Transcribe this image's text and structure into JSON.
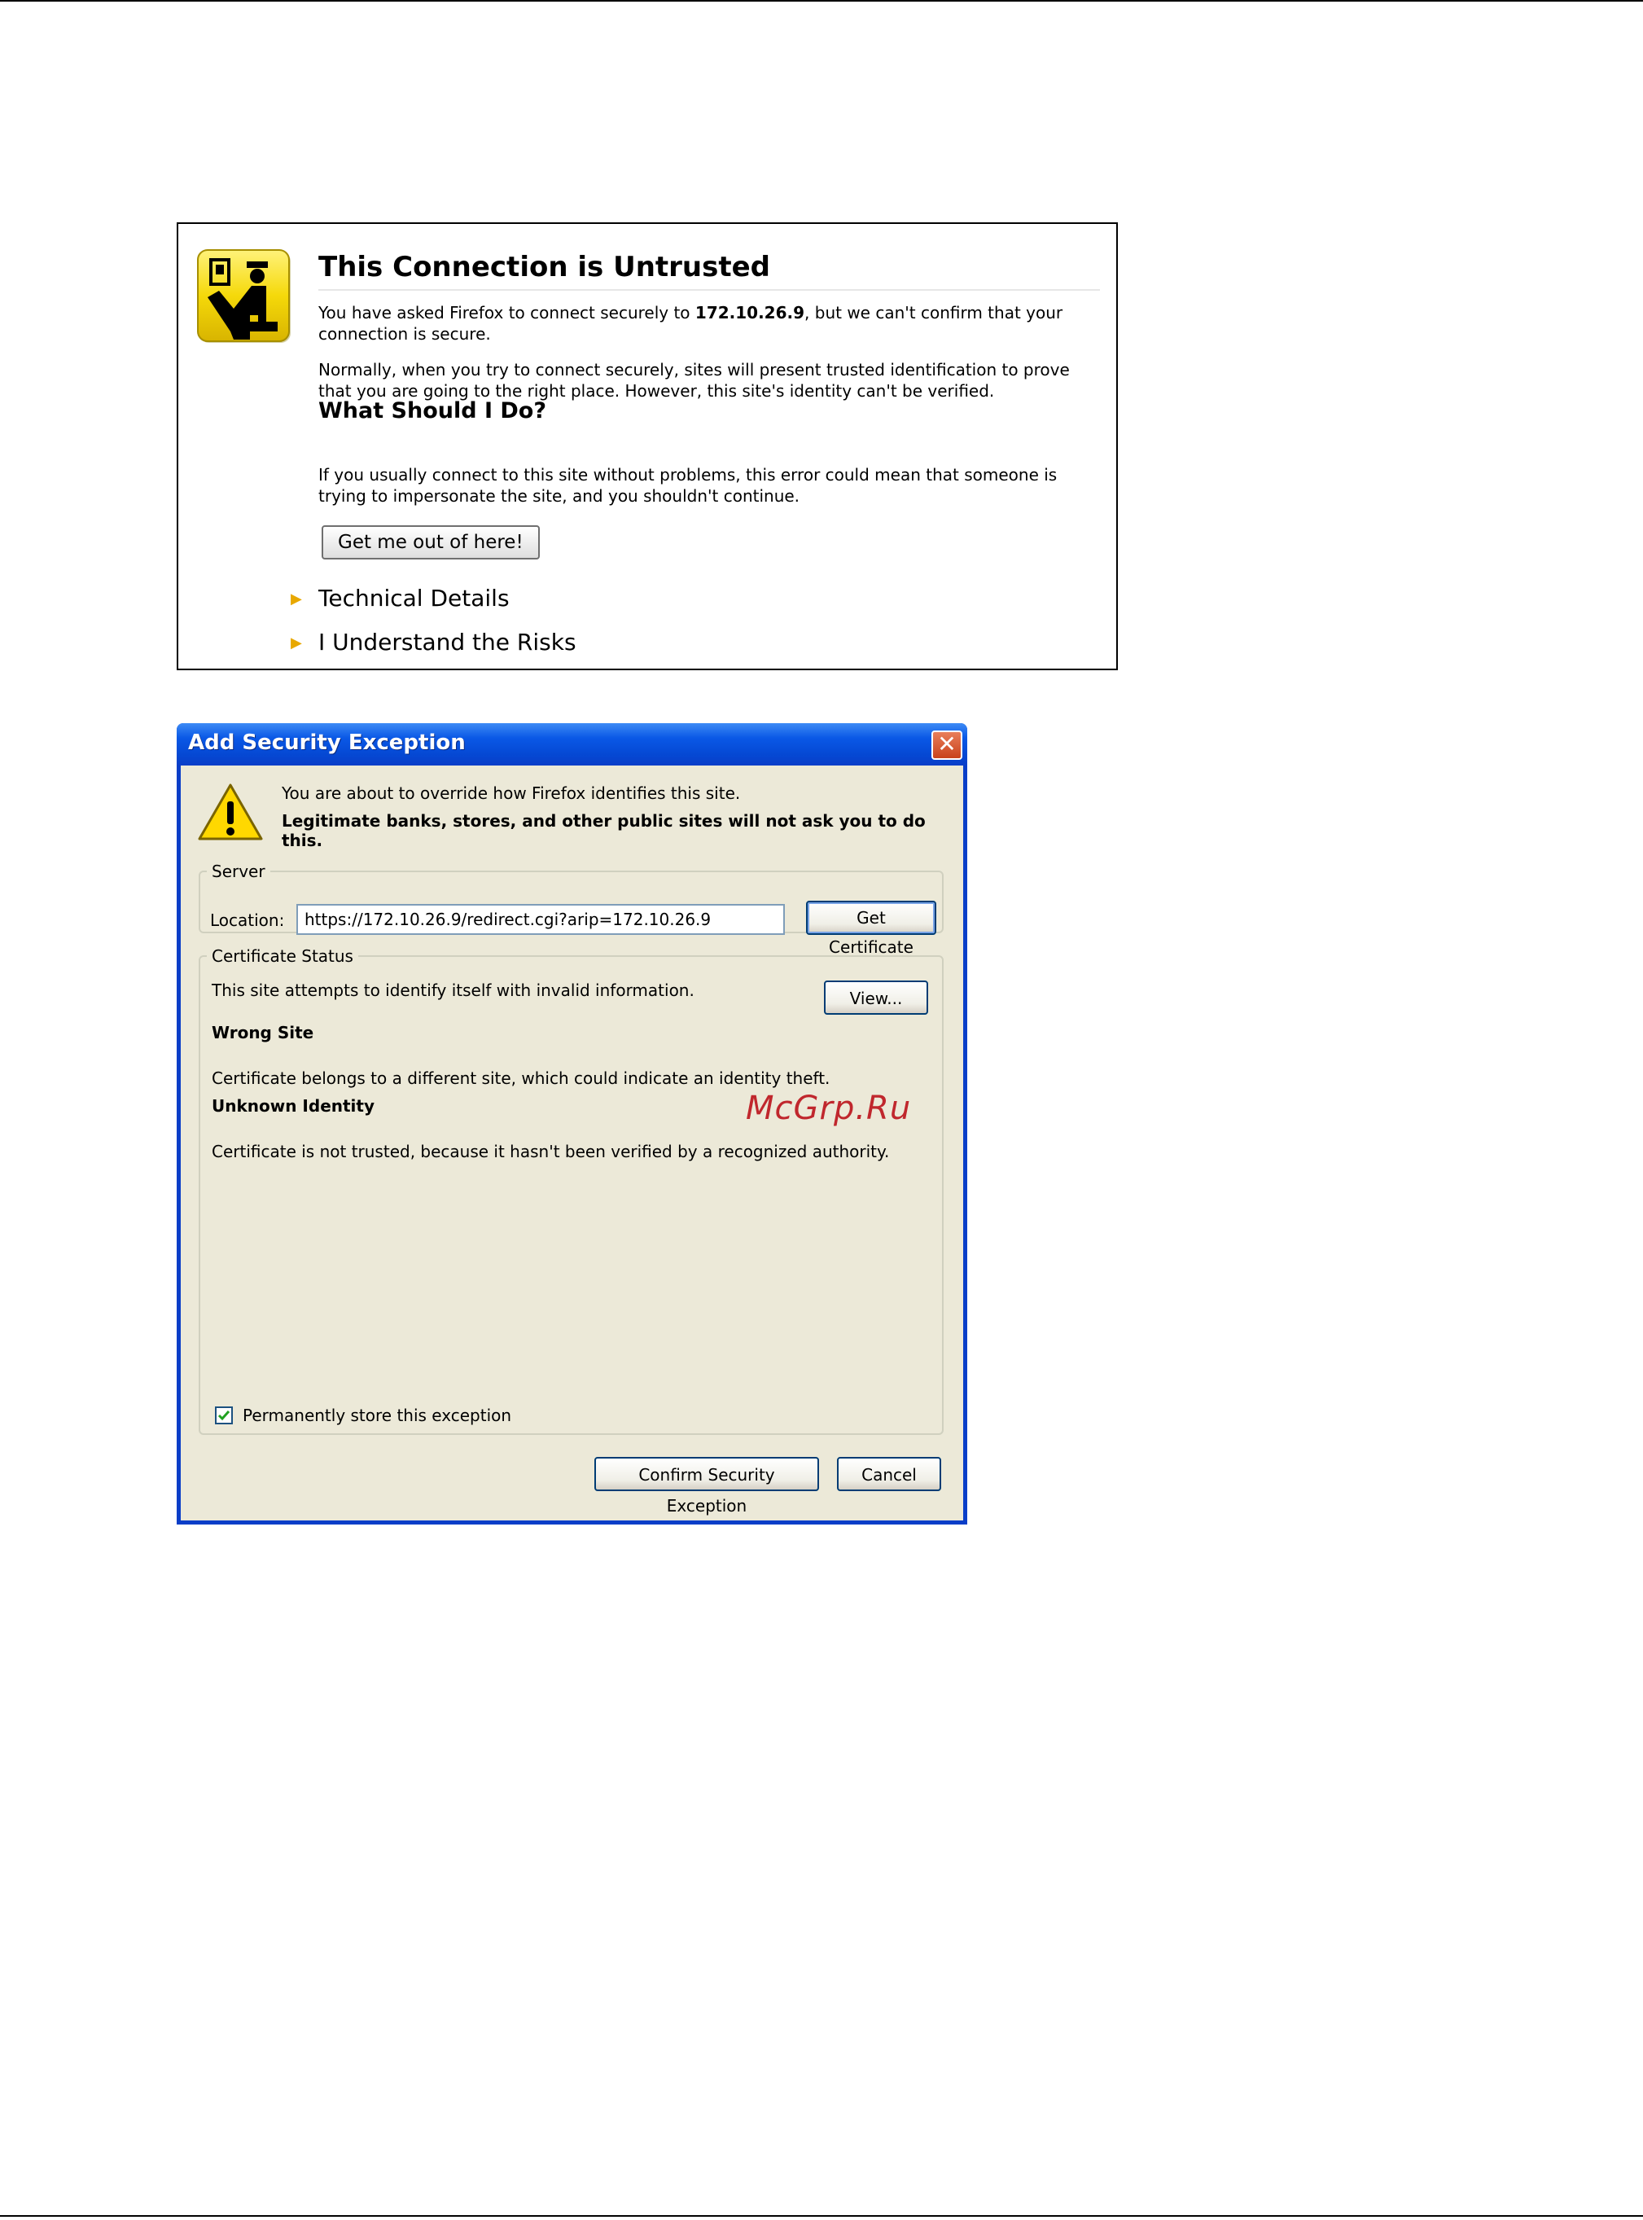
{
  "untrusted": {
    "title": "This Connection is Untrusted",
    "para1_pre": "You have asked Firefox to connect securely to ",
    "para1_host": "172.10.26.9",
    "para1_post": ", but we can't confirm that your connection is secure.",
    "para2": "Normally, when you try to connect securely, sites will present trusted identification to prove that you are going to the right place. However, this site's identity can't be verified.",
    "what_heading": "What Should I Do?",
    "para3": "If you usually connect to this site without problems, this error could mean that someone is trying to impersonate the site, and you shouldn't continue.",
    "get_out_button": "Get me out of here!",
    "technical_details": "Technical Details",
    "understand_risks": "I Understand the Risks",
    "accent_color": "#e8a800",
    "badge_icon": "officer-badge-icon"
  },
  "dialog": {
    "title": "Add Security Exception",
    "intro_line1": "You are about to override how Firefox identifies this site.",
    "intro_line2": "Legitimate banks, stores, and other public sites will not ask you to do this.",
    "server": {
      "legend": "Server",
      "location_label": "Location:",
      "location_value": "https://172.10.26.9/redirect.cgi?arip=172.10.26.9",
      "get_certificate_button": "Get Certificate"
    },
    "certificate_status": {
      "legend": "Certificate Status",
      "summary": "This site attempts to identify itself with invalid information.",
      "view_button": "View...",
      "wrong_site_heading": "Wrong Site",
      "wrong_site_text": "Certificate belongs to a different site, which could indicate an identity theft.",
      "unknown_identity_heading": "Unknown Identity",
      "unknown_identity_text": "Certificate is not trusted, because it hasn't been verified by a recognized authority."
    },
    "permanent_store_label": "Permanently store this exception",
    "permanent_store_checked": true,
    "confirm_button": "Confirm Security Exception",
    "cancel_button": "Cancel",
    "titlebar_color": "#0a58e6",
    "body_color": "#ece9d8"
  },
  "watermark": "McGrp.Ru"
}
